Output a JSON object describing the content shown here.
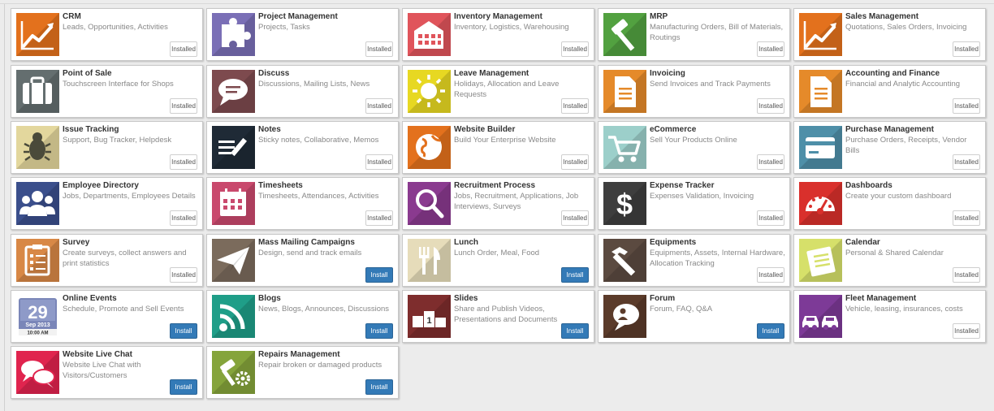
{
  "apps": [
    {
      "title": "CRM",
      "desc": "Leads, Opportunities, Activities",
      "button": "Installed",
      "state": "installed",
      "icon": "chart-line-icon",
      "color": "#e3711d"
    },
    {
      "title": "Project Management",
      "desc": "Projects, Tasks",
      "button": "Installed",
      "state": "installed",
      "icon": "puzzle-icon",
      "color": "#7a6fb6"
    },
    {
      "title": "Inventory Management",
      "desc": "Inventory, Logistics, Warehousing",
      "button": "Installed",
      "state": "installed",
      "icon": "warehouse-icon",
      "color": "#e0545b"
    },
    {
      "title": "MRP",
      "desc": "Manufacturing Orders, Bill of Materials, Routings",
      "button": "Installed",
      "state": "installed",
      "icon": "hammer-icon",
      "color": "#52a140"
    },
    {
      "title": "Sales Management",
      "desc": "Quotations, Sales Orders, Invoicing",
      "button": "Installed",
      "state": "installed",
      "icon": "chart-line-icon",
      "color": "#e3711d"
    },
    {
      "title": "Point of Sale",
      "desc": "Touchscreen Interface for Shops",
      "button": "Installed",
      "state": "installed",
      "icon": "briefcase-icon",
      "color": "#646e6f"
    },
    {
      "title": "Discuss",
      "desc": "Discussions, Mailing Lists, News",
      "button": "Installed",
      "state": "installed",
      "icon": "chat-bubble-icon",
      "color": "#7d4a4e"
    },
    {
      "title": "Leave Management",
      "desc": "Holidays, Allocation and Leave Requests",
      "button": "Installed",
      "state": "installed",
      "icon": "sun-icon",
      "color": "#e7d822"
    },
    {
      "title": "Invoicing",
      "desc": "Send Invoices and Track Payments",
      "button": "Installed",
      "state": "installed",
      "icon": "document-icon",
      "color": "#e58a2a"
    },
    {
      "title": "Accounting and Finance",
      "desc": "Financial and Analytic Accounting",
      "button": "Installed",
      "state": "installed",
      "icon": "document-icon",
      "color": "#e58a2a"
    },
    {
      "title": "Issue Tracking",
      "desc": "Support, Bug Tracker, Helpdesk",
      "button": "Installed",
      "state": "installed",
      "icon": "bug-icon",
      "color": "#e3d79d"
    },
    {
      "title": "Notes",
      "desc": "Sticky notes, Collaborative, Memos",
      "button": "Installed",
      "state": "installed",
      "icon": "notes-pencil-icon",
      "color": "#1f2a36"
    },
    {
      "title": "Website Builder",
      "desc": "Build Your Enterprise Website",
      "button": "Installed",
      "state": "installed",
      "icon": "globe-icon",
      "color": "#e3711d"
    },
    {
      "title": "eCommerce",
      "desc": "Sell Your Products Online",
      "button": "Installed",
      "state": "installed",
      "icon": "cart-icon",
      "color": "#9ccfca"
    },
    {
      "title": "Purchase Management",
      "desc": "Purchase Orders, Receipts, Vendor Bills",
      "button": "Installed",
      "state": "installed",
      "icon": "credit-card-icon",
      "color": "#4e8fa8"
    },
    {
      "title": "Employee Directory",
      "desc": "Jobs, Departments, Employees Details",
      "button": "Installed",
      "state": "installed",
      "icon": "users-icon",
      "color": "#3b4f8c"
    },
    {
      "title": "Timesheets",
      "desc": "Timesheets, Attendances, Activities",
      "button": "Installed",
      "state": "installed",
      "icon": "calendar-grid-icon",
      "color": "#c9496d"
    },
    {
      "title": "Recruitment Process",
      "desc": "Jobs, Recruitment, Applications, Job Interviews, Surveys",
      "button": "Installed",
      "state": "installed",
      "icon": "magnifier-icon",
      "color": "#8a3a8f"
    },
    {
      "title": "Expense Tracker",
      "desc": "Expenses Validation, Invoicing",
      "button": "Installed",
      "state": "installed",
      "icon": "dollar-icon",
      "color": "#3e3e3e"
    },
    {
      "title": "Dashboards",
      "desc": "Create your custom dashboard",
      "button": "Installed",
      "state": "installed",
      "icon": "gauge-icon",
      "color": "#d9302c"
    },
    {
      "title": "Survey",
      "desc": "Create surveys, collect answers and print statistics",
      "button": "Installed",
      "state": "installed",
      "icon": "clipboard-icon",
      "color": "#d88846"
    },
    {
      "title": "Mass Mailing Campaigns",
      "desc": "Design, send and track emails",
      "button": "Install",
      "state": "install",
      "icon": "paper-plane-icon",
      "color": "#7b6b5c"
    },
    {
      "title": "Lunch",
      "desc": "Lunch Order, Meal, Food",
      "button": "Install",
      "state": "install",
      "icon": "fork-knife-icon",
      "color": "#e6dcba"
    },
    {
      "title": "Equipments",
      "desc": "Equipments, Assets, Internal Hardware, Allocation Tracking",
      "button": "Installed",
      "state": "installed",
      "icon": "hammer-tool-icon",
      "color": "#5b4a40"
    },
    {
      "title": "Calendar",
      "desc": "Personal & Shared Calendar",
      "button": "Installed",
      "state": "installed",
      "icon": "calendar-book-icon",
      "color": "#d6e06a"
    },
    {
      "title": "Online Events",
      "desc": "Schedule, Promote and Sell Events",
      "button": "Install",
      "state": "install",
      "icon": "event-calendar-icon",
      "color": "#ffffff",
      "cal_day": "29",
      "cal_month": "Sep 2013",
      "cal_time": "10:00 AM"
    },
    {
      "title": "Blogs",
      "desc": "News, Blogs, Announces, Discussions",
      "button": "Install",
      "state": "install",
      "icon": "rss-icon",
      "color": "#1f9e88"
    },
    {
      "title": "Slides",
      "desc": "Share and Publish Videos, Presentations and Documents",
      "button": "Install",
      "state": "install",
      "icon": "slides-podium-icon",
      "color": "#7e2d2d",
      "podium": "1"
    },
    {
      "title": "Forum",
      "desc": "Forum, FAQ, Q&A",
      "button": "Install",
      "state": "install",
      "icon": "forum-bubble-icon",
      "color": "#5b3b2a"
    },
    {
      "title": "Fleet Management",
      "desc": "Vehicle, leasing, insurances, costs",
      "button": "Installed",
      "state": "installed",
      "icon": "cars-icon",
      "color": "#7d3a97"
    },
    {
      "title": "Website Live Chat",
      "desc": "Website Live Chat with Visitors/Customers",
      "button": "Install",
      "state": "install",
      "icon": "chat-bubbles-icon",
      "color": "#e0244e"
    },
    {
      "title": "Repairs Management",
      "desc": "Repair broken or damaged products",
      "button": "Install",
      "state": "install",
      "icon": "hammer-gear-icon",
      "color": "#85a43b"
    }
  ]
}
